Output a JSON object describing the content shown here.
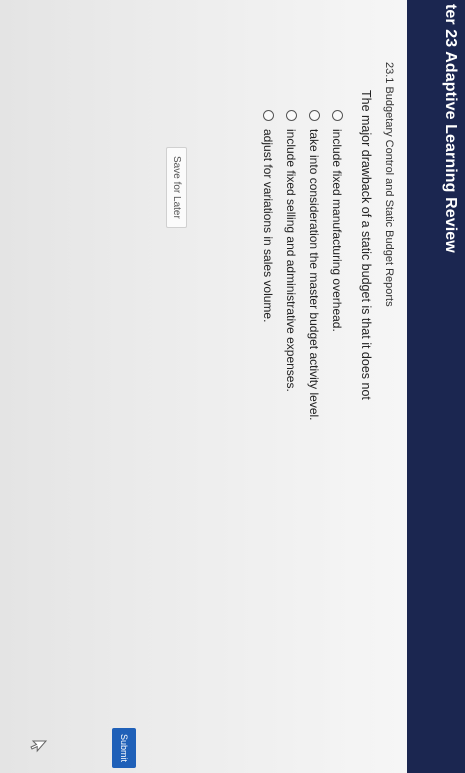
{
  "header": {
    "title": "ter 23 Adaptive Learning Review"
  },
  "section": {
    "title": "23.1 Budgetary Control and Static Budget Reports"
  },
  "question": {
    "prompt": "The major drawback of a static budget is that it does not",
    "options": [
      {
        "label": "include fixed manufacturing overhead."
      },
      {
        "label": "take into consideration the master budget activity level."
      },
      {
        "label": "include fixed selling and administrative expenses."
      },
      {
        "label": "adjust for variations in sales volume."
      }
    ]
  },
  "actions": {
    "save_later_label": "Save for Later",
    "submit_label": "Submit"
  },
  "colors": {
    "header_bg": "#1b2650",
    "submit_bg": "#1f60b8"
  },
  "icons": {
    "cursor": "mouse-pointer-icon"
  }
}
